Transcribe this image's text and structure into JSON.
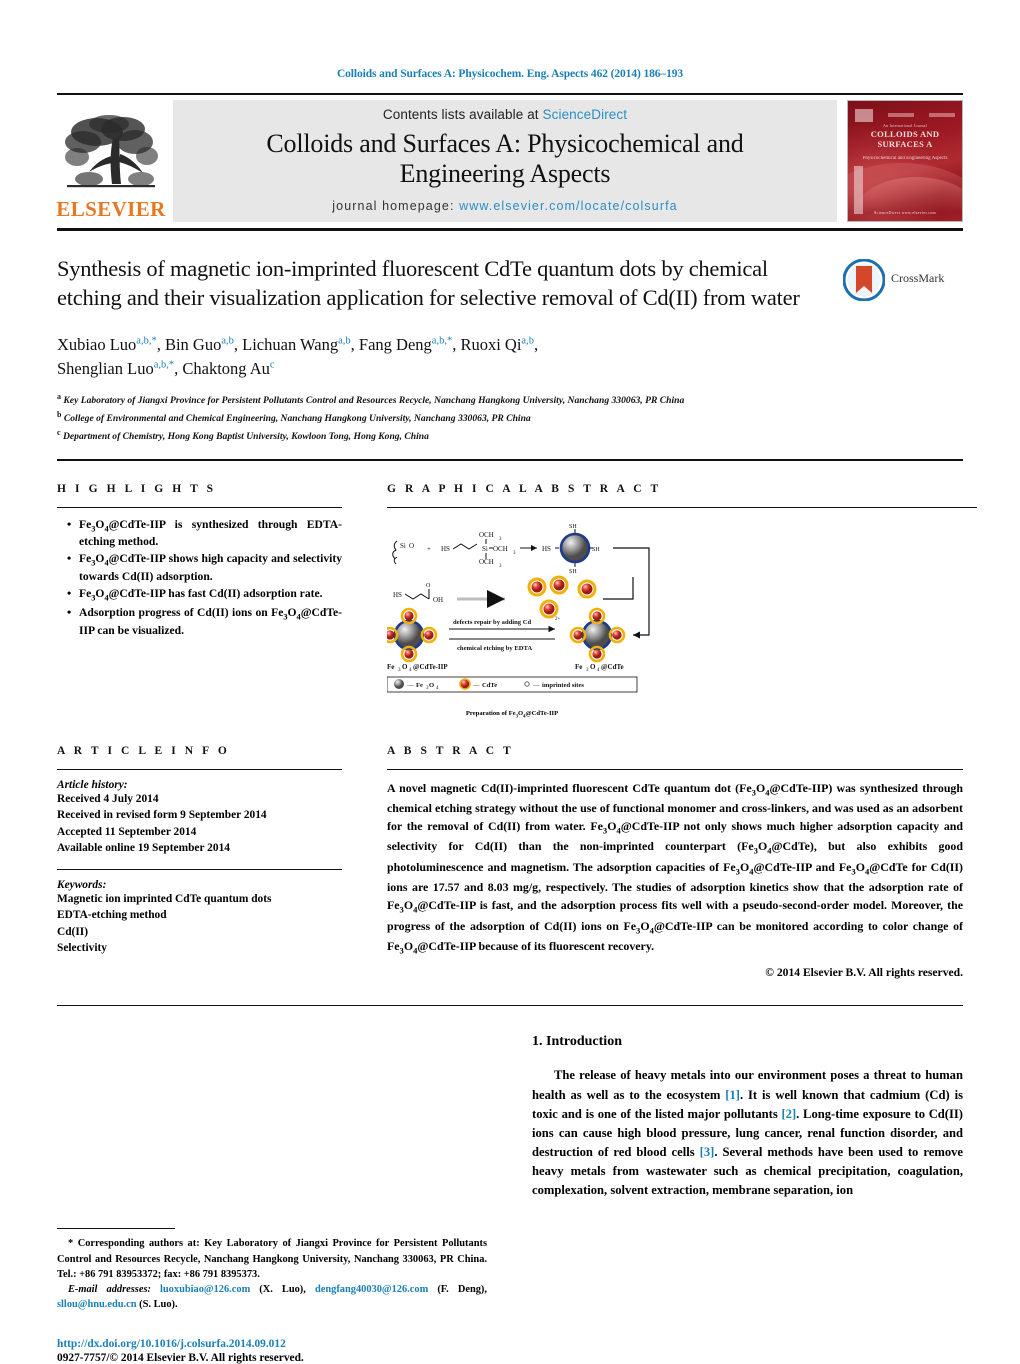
{
  "running_head": "Colloids and Surfaces A: Physicochem. Eng. Aspects 462 (2014) 186–193",
  "masthead": {
    "contents_prefix": "Contents lists available at ",
    "sciencedirect": "ScienceDirect",
    "journal_title_line1": "Colloids and Surfaces A: Physicochemical and",
    "journal_title_line2": "Engineering Aspects",
    "homepage_label": "journal homepage:",
    "homepage_url": "www.elsevier.com/locate/colsurfa",
    "publisher": "ELSEVIER",
    "cover": {
      "line_small": "An International Journal",
      "title": "COLLOIDS AND SURFACES A",
      "subtitle": "Physicochemical and Engineering Aspects",
      "footer": "ScienceDirect    www.elsevier.com"
    }
  },
  "article": {
    "title": "Synthesis of magnetic ion-imprinted fluorescent CdTe quantum dots by chemical etching and their visualization application for selective removal of Cd(II) from water",
    "crossmark_label": "CrossMark",
    "authors_line1_parts": [
      {
        "name": "Xubiao Luo",
        "sup": "a,b,*"
      },
      {
        "name": "Bin Guo",
        "sup": "a,b"
      },
      {
        "name": "Lichuan Wang",
        "sup": "a,b"
      },
      {
        "name": "Fang Deng",
        "sup": "a,b,*"
      },
      {
        "name": "Ruoxi Qi",
        "sup": "a,b"
      }
    ],
    "authors_line2_parts": [
      {
        "name": "Shenglian Luo",
        "sup": "a,b,*"
      },
      {
        "name": "Chaktong Au",
        "sup": "c"
      }
    ],
    "affiliations": [
      {
        "marker": "a",
        "text": "Key Laboratory of Jiangxi Province for Persistent Pollutants Control and Resources Recycle, Nanchang Hangkong University, Nanchang 330063, PR China"
      },
      {
        "marker": "b",
        "text": "College of Environmental and Chemical Engineering, Nanchang Hangkong University, Nanchang 330063, PR China"
      },
      {
        "marker": "c",
        "text": "Department of Chemistry, Hong Kong Baptist University, Kowloon Tong, Hong Kong, China"
      }
    ]
  },
  "highlights": {
    "heading": "H I G H L I G H T S",
    "items": [
      "Fe3O4@CdTe-IIP is synthesized through EDTA-etching method.",
      "Fe3O4@CdTe-IIP shows high capacity and selectivity towards Cd(II) adsorption.",
      "Fe3O4@CdTe-IIP has fast Cd(II) adsorption rate.",
      "Adsorption progress of Cd(II) ions on Fe3O4@CdTe-IIP can be visualized."
    ]
  },
  "graphical_abstract": {
    "heading": "G R A P H I C A L   A B S T R A C T",
    "caption": "Preparation of Fe3O4@CdTe-IIP",
    "labels": {
      "ocH3_top": "OCH3",
      "ocH3_mid": "OCH3",
      "ocH3_bot": "OCH3",
      "si": "Si",
      "hs_left": "HS",
      "hs_label": "HS",
      "sh_top": "SH",
      "sh_right": "SH",
      "sh_bottom": "SH",
      "oh": "OH",
      "arrow_top_text": "defects repair by adding Cd2+",
      "arrow_bottom_text": "chemical etching by EDTA",
      "product_left": "Fe3O4@CdTe-IIP",
      "product_right": "Fe3O4@CdTe",
      "legend_fe": "Fe3O4",
      "legend_cdte": "CdTe",
      "legend_imprinted": "imprinted sites"
    }
  },
  "article_info": {
    "heading": "A R T I C L E   I N F O",
    "history_label": "Article history:",
    "history": [
      "Received 4 July 2014",
      "Received in revised form 9 September 2014",
      "Accepted 11 September 2014",
      "Available online 19 September 2014"
    ],
    "keywords_label": "Keywords:",
    "keywords": [
      "Magnetic ion imprinted CdTe quantum dots",
      "EDTA-etching method",
      "Cd(II)",
      "Selectivity"
    ]
  },
  "abstract": {
    "heading": "A B S T R A C T",
    "text_segments": [
      "A novel magnetic Cd(II)-imprinted fluorescent CdTe quantum dot (Fe",
      "3",
      "O",
      "4",
      "@CdTe-IIP) was synthesized through chemical etching strategy without the use of functional monomer and cross-linkers, and was used as an adsorbent for the removal of Cd(II) from water. Fe3O4@CdTe-IIP not only shows much higher adsorption capacity and selectivity for Cd(II) than the non-imprinted counterpart (Fe3O4@CdTe), but also exhibits good photoluminescence and magnetism. The adsorption capacities of Fe3O4@CdTe-IIP and Fe3O4@CdTe for Cd(II) ions are 17.57 and 8.03 mg/g, respectively. The studies of adsorption kinetics show that the adsorption rate of Fe3O4@CdTe-IIP is fast, and the adsorption process fits well with a pseudo-second-order model. Moreover, the progress of the adsorption of Cd(II) ions on Fe3O4@CdTe-IIP can be monitored according to color change of Fe3O4@CdTe-IIP because of its fluorescent recovery."
    ],
    "copyright": "© 2014 Elsevier B.V. All rights reserved."
  },
  "introduction": {
    "heading": "1. Introduction",
    "paragraph": "The release of heavy metals into our environment poses a threat to human health as well as to the ecosystem [1]. It is well known that cadmium (Cd) is toxic and is one of the listed major pollutants [2]. Long-time exposure to Cd(II) ions can cause high blood pressure, lung cancer, renal function disorder, and destruction of red blood cells [3]. Several methods have been used to remove heavy metals from wastewater such as chemical precipitation, coagulation, complexation, solvent extraction, membrane separation, ion",
    "refs": [
      "[1]",
      "[2]",
      "[3]"
    ]
  },
  "footnote": {
    "corresponding": "* Corresponding authors at: Key Laboratory of Jiangxi Province for Persistent Pollutants Control and Resources Recycle, Nanchang Hangkong University, Nanchang 330063, PR China. Tel.: +86 791 83953372; fax: +86 791 8395373.",
    "email_label": "E-mail addresses:",
    "emails": [
      {
        "address": "luoxubiao@126.com",
        "owner": "(X. Luo)"
      },
      {
        "address": "dengfang40030@126.com",
        "owner": "(F. Deng)"
      },
      {
        "address": "sllou@hnu.edu.cn",
        "owner": "(S. Luo)"
      }
    ],
    "doi": "http://dx.doi.org/10.1016/j.colsurfa.2014.09.012",
    "issn": "0927-7757/© 2014 Elsevier B.V. All rights reserved."
  },
  "colors": {
    "link_blue": "#1a7fb5",
    "sciencedirect_blue": "#2a8ec4",
    "elsevier_orange": "#E87722",
    "band_gray": "#e7e7e7",
    "cover_red": "#9c1822"
  }
}
